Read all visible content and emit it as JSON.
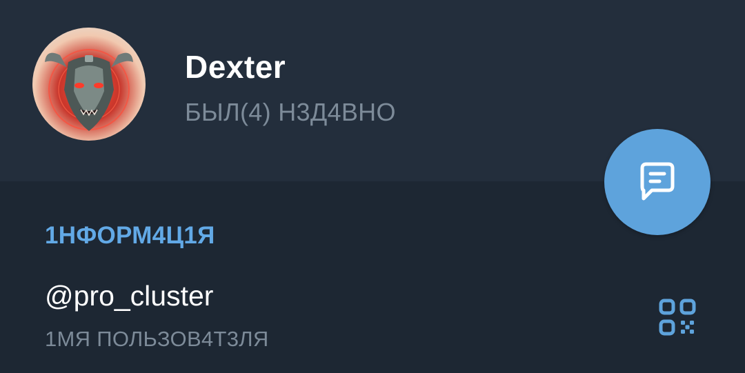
{
  "profile": {
    "name": "Dexter",
    "status": "БЫЛ(4) Н3Д4ВНО",
    "avatar_icon": "bull-avatar-icon"
  },
  "fab": {
    "icon": "message-icon"
  },
  "info": {
    "section_title": "1НФОРМ4Ц1Я",
    "username": "@pro_cluster",
    "username_caption": "1МЯ ПОЛЬЗОВ4Т3ЛЯ",
    "qr_icon": "qr-code-icon"
  },
  "colors": {
    "header_bg": "#232e3c",
    "body_bg": "#1d2733",
    "accent": "#5ea3dc",
    "section_title": "#62a9e6",
    "secondary_text": "#7d8b99"
  }
}
